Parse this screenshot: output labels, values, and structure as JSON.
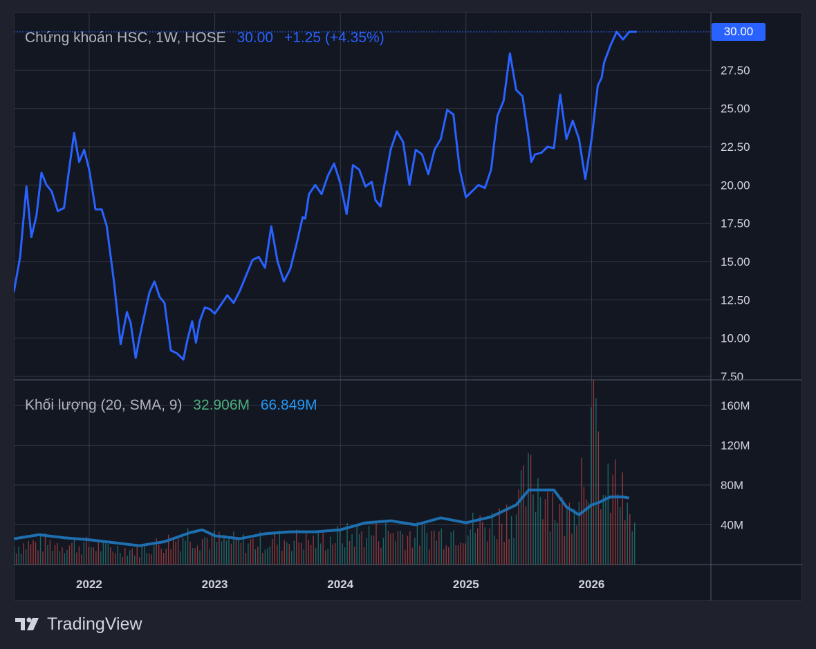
{
  "header": {
    "symbol_title": "Chứng khoán HSC, 1W, HOSE",
    "last_price": "30.00",
    "change": "+1.25 (+4.35%)"
  },
  "volume_legend": {
    "title": "Khối lượng (20, SMA, 9)",
    "volume_value": "32.906M",
    "ma_value": "66.849M"
  },
  "last_price_badge": "30.00",
  "brand": {
    "name": "TradingView"
  },
  "colors": {
    "price_line": "#2962ff",
    "volume_up": "#26a69a",
    "volume_down": "#ef5350",
    "volume_ma": "#1e6fb0",
    "background": "#131722"
  },
  "chart_data": [
    {
      "type": "line",
      "title": "Chứng khoán HSC, 1W, HOSE",
      "x_ticks": [
        "2022",
        "2023",
        "2024",
        "2025",
        "2026"
      ],
      "y_ticks": [
        "7.50",
        "10.00",
        "12.50",
        "15.00",
        "17.50",
        "20.00",
        "22.50",
        "25.00",
        "27.50",
        "30.00"
      ],
      "ylim": [
        7.5,
        30
      ],
      "grid": true,
      "series": [
        {
          "x": [
            2021.4,
            2021.45,
            2021.5,
            2021.54,
            2021.58,
            2021.62,
            2021.66,
            2021.7,
            2021.75,
            2021.8,
            2021.84,
            2021.88,
            2021.92,
            2021.96,
            2022.0,
            2022.05,
            2022.1,
            2022.14,
            2022.2,
            2022.25,
            2022.3,
            2022.33,
            2022.37,
            2022.4,
            2022.45,
            2022.48,
            2022.52,
            2022.56,
            2022.6,
            2022.65,
            2022.7,
            2022.75,
            2022.78,
            2022.82,
            2022.85,
            2022.88,
            2022.92,
            2022.96,
            2023.0,
            2023.05,
            2023.1,
            2023.15,
            2023.2,
            2023.25,
            2023.3,
            2023.35,
            2023.4,
            2023.45,
            2023.5,
            2023.55,
            2023.6,
            2023.65,
            2023.7,
            2023.72,
            2023.75,
            2023.8,
            2023.85,
            2023.9,
            2023.95,
            2024.0,
            2024.05,
            2024.1,
            2024.15,
            2024.2,
            2024.25,
            2024.28,
            2024.32,
            2024.35,
            2024.4,
            2024.45,
            2024.5,
            2024.55,
            2024.6,
            2024.65,
            2024.7,
            2024.75,
            2024.8,
            2024.85,
            2024.9,
            2024.95,
            2025.0,
            2025.05,
            2025.1,
            2025.15,
            2025.2,
            2025.25,
            2025.3,
            2025.35,
            2025.4,
            2025.45,
            2025.5,
            2025.52,
            2025.55,
            2025.6,
            2025.65,
            2025.7,
            2025.75,
            2025.8,
            2025.85,
            2025.9,
            2025.95,
            2026.0,
            2026.02,
            2026.05,
            2026.08,
            2026.1,
            2026.15,
            2026.2,
            2026.25,
            2026.3,
            2026.33,
            2026.36
          ],
          "values": [
            13.0,
            15.3,
            19.9,
            16.6,
            18.0,
            20.8,
            20.0,
            19.6,
            18.3,
            18.5,
            21.0,
            23.4,
            21.5,
            22.3,
            21.0,
            18.4,
            18.4,
            17.3,
            13.5,
            9.6,
            11.7,
            11.0,
            8.7,
            10.0,
            11.9,
            13.0,
            13.7,
            12.7,
            12.3,
            9.2,
            9.0,
            8.6,
            9.8,
            11.1,
            9.7,
            11.1,
            12.0,
            11.9,
            11.6,
            12.2,
            12.8,
            12.3,
            13.1,
            14.1,
            15.1,
            15.3,
            14.6,
            17.3,
            15.0,
            13.7,
            14.5,
            16.1,
            17.9,
            17.8,
            19.4,
            20.0,
            19.4,
            20.6,
            21.4,
            20.1,
            18.1,
            21.3,
            21.0,
            19.9,
            20.2,
            19.0,
            18.6,
            20.0,
            22.3,
            23.5,
            22.8,
            20.0,
            22.3,
            22.0,
            20.7,
            22.3,
            23.0,
            24.9,
            24.6,
            21.0,
            19.2,
            19.6,
            20.0,
            19.8,
            21.0,
            24.5,
            25.5,
            28.6,
            26.2,
            25.8,
            23.0,
            21.5,
            22.0,
            22.1,
            22.5,
            22.4,
            25.9,
            23.0,
            24.2,
            23.0,
            20.4,
            23.0,
            24.4,
            26.5,
            27.0,
            28.0,
            29.1,
            30.0,
            29.5,
            30.0,
            30.0,
            30.0
          ],
          "name": ""
        }
      ]
    },
    {
      "type": "bar",
      "title": "Khối lượng (20, SMA, 9)",
      "x_ticks": [
        "2022",
        "2023",
        "2024",
        "2025",
        "2026"
      ],
      "y_ticks": [
        "40M",
        "80M",
        "120M",
        "160M"
      ],
      "ylim": [
        0,
        185
      ],
      "grid": true,
      "series": [
        {
          "name": "",
          "x": [
            2021.4,
            2021.6,
            2021.8,
            2022.0,
            2022.2,
            2022.4,
            2022.6,
            2022.8,
            2023.0,
            2023.2,
            2023.4,
            2023.6,
            2023.8,
            2024.0,
            2024.2,
            2024.4,
            2024.6,
            2024.8,
            2025.0,
            2025.2,
            2025.4,
            2025.5,
            2025.6,
            2025.8,
            2026.0,
            2026.05,
            2026.1,
            2026.2,
            2026.3
          ],
          "values": [
            25,
            30,
            28,
            26,
            22,
            20,
            30,
            42,
            33,
            30,
            31,
            35,
            32,
            38,
            42,
            45,
            40,
            42,
            50,
            55,
            75,
            110,
            112,
            60,
            182,
            158,
            85,
            115,
            55
          ]
        },
        {
          "name": "",
          "type": "line",
          "x": [
            2021.4,
            2021.6,
            2021.8,
            2022.0,
            2022.2,
            2022.4,
            2022.6,
            2022.8,
            2022.9,
            2023.0,
            2023.2,
            2023.4,
            2023.6,
            2023.8,
            2024.0,
            2024.2,
            2024.4,
            2024.6,
            2024.8,
            2025.0,
            2025.2,
            2025.4,
            2025.5,
            2025.6,
            2025.7,
            2025.8,
            2025.9,
            2026.0,
            2026.05,
            2026.15,
            2026.25,
            2026.3
          ],
          "values": [
            26,
            30,
            27,
            25,
            22,
            19,
            23,
            32,
            35,
            29,
            26,
            31,
            33,
            33,
            35,
            42,
            44,
            40,
            47,
            42,
            48,
            60,
            75,
            75,
            75,
            58,
            50,
            60,
            62,
            68,
            68,
            67
          ]
        }
      ]
    }
  ]
}
